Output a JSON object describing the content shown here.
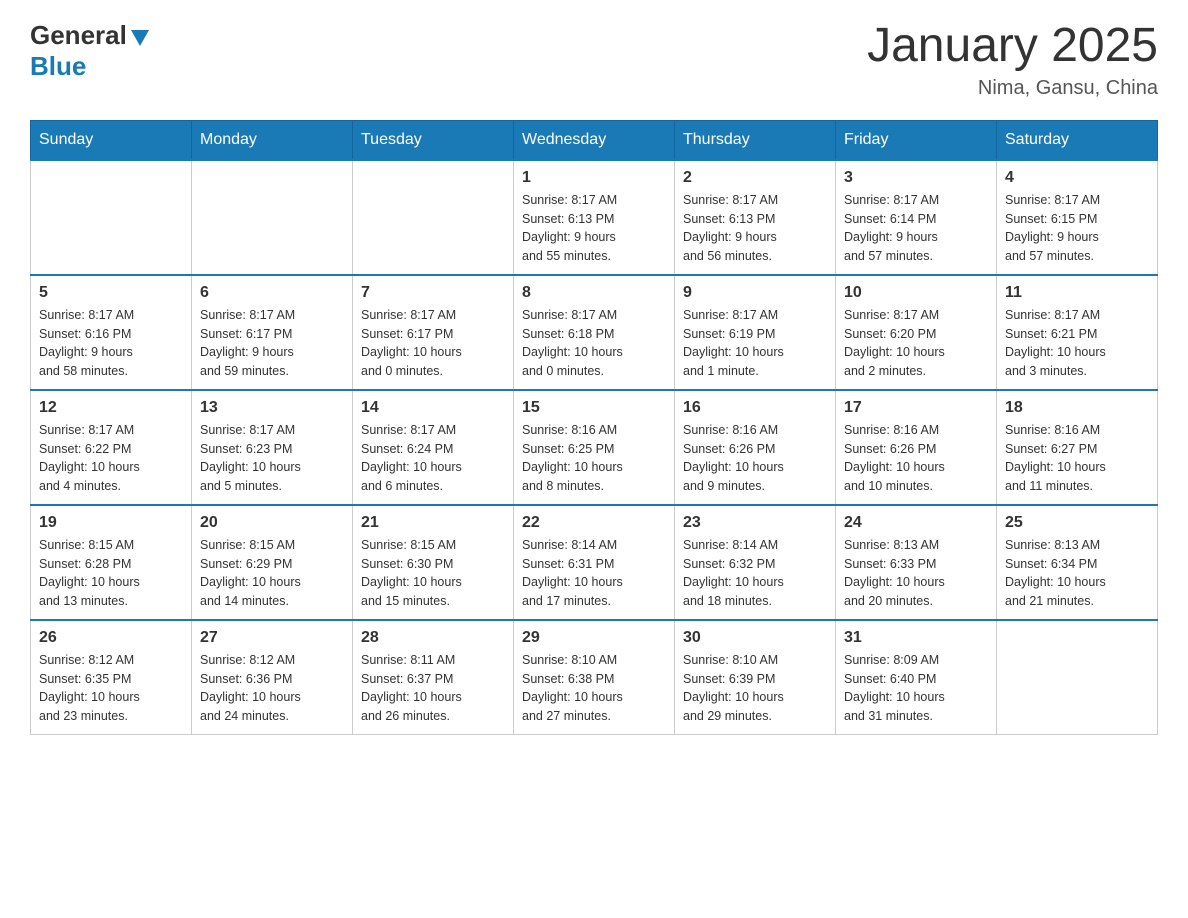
{
  "header": {
    "logo": {
      "general": "General",
      "blue": "Blue",
      "tagline": "Blue"
    },
    "title": "January 2025",
    "location": "Nima, Gansu, China"
  },
  "days_of_week": [
    "Sunday",
    "Monday",
    "Tuesday",
    "Wednesday",
    "Thursday",
    "Friday",
    "Saturday"
  ],
  "weeks": [
    [
      {
        "day": "",
        "info": ""
      },
      {
        "day": "",
        "info": ""
      },
      {
        "day": "",
        "info": ""
      },
      {
        "day": "1",
        "info": "Sunrise: 8:17 AM\nSunset: 6:13 PM\nDaylight: 9 hours\nand 55 minutes."
      },
      {
        "day": "2",
        "info": "Sunrise: 8:17 AM\nSunset: 6:13 PM\nDaylight: 9 hours\nand 56 minutes."
      },
      {
        "day": "3",
        "info": "Sunrise: 8:17 AM\nSunset: 6:14 PM\nDaylight: 9 hours\nand 57 minutes."
      },
      {
        "day": "4",
        "info": "Sunrise: 8:17 AM\nSunset: 6:15 PM\nDaylight: 9 hours\nand 57 minutes."
      }
    ],
    [
      {
        "day": "5",
        "info": "Sunrise: 8:17 AM\nSunset: 6:16 PM\nDaylight: 9 hours\nand 58 minutes."
      },
      {
        "day": "6",
        "info": "Sunrise: 8:17 AM\nSunset: 6:17 PM\nDaylight: 9 hours\nand 59 minutes."
      },
      {
        "day": "7",
        "info": "Sunrise: 8:17 AM\nSunset: 6:17 PM\nDaylight: 10 hours\nand 0 minutes."
      },
      {
        "day": "8",
        "info": "Sunrise: 8:17 AM\nSunset: 6:18 PM\nDaylight: 10 hours\nand 0 minutes."
      },
      {
        "day": "9",
        "info": "Sunrise: 8:17 AM\nSunset: 6:19 PM\nDaylight: 10 hours\nand 1 minute."
      },
      {
        "day": "10",
        "info": "Sunrise: 8:17 AM\nSunset: 6:20 PM\nDaylight: 10 hours\nand 2 minutes."
      },
      {
        "day": "11",
        "info": "Sunrise: 8:17 AM\nSunset: 6:21 PM\nDaylight: 10 hours\nand 3 minutes."
      }
    ],
    [
      {
        "day": "12",
        "info": "Sunrise: 8:17 AM\nSunset: 6:22 PM\nDaylight: 10 hours\nand 4 minutes."
      },
      {
        "day": "13",
        "info": "Sunrise: 8:17 AM\nSunset: 6:23 PM\nDaylight: 10 hours\nand 5 minutes."
      },
      {
        "day": "14",
        "info": "Sunrise: 8:17 AM\nSunset: 6:24 PM\nDaylight: 10 hours\nand 6 minutes."
      },
      {
        "day": "15",
        "info": "Sunrise: 8:16 AM\nSunset: 6:25 PM\nDaylight: 10 hours\nand 8 minutes."
      },
      {
        "day": "16",
        "info": "Sunrise: 8:16 AM\nSunset: 6:26 PM\nDaylight: 10 hours\nand 9 minutes."
      },
      {
        "day": "17",
        "info": "Sunrise: 8:16 AM\nSunset: 6:26 PM\nDaylight: 10 hours\nand 10 minutes."
      },
      {
        "day": "18",
        "info": "Sunrise: 8:16 AM\nSunset: 6:27 PM\nDaylight: 10 hours\nand 11 minutes."
      }
    ],
    [
      {
        "day": "19",
        "info": "Sunrise: 8:15 AM\nSunset: 6:28 PM\nDaylight: 10 hours\nand 13 minutes."
      },
      {
        "day": "20",
        "info": "Sunrise: 8:15 AM\nSunset: 6:29 PM\nDaylight: 10 hours\nand 14 minutes."
      },
      {
        "day": "21",
        "info": "Sunrise: 8:15 AM\nSunset: 6:30 PM\nDaylight: 10 hours\nand 15 minutes."
      },
      {
        "day": "22",
        "info": "Sunrise: 8:14 AM\nSunset: 6:31 PM\nDaylight: 10 hours\nand 17 minutes."
      },
      {
        "day": "23",
        "info": "Sunrise: 8:14 AM\nSunset: 6:32 PM\nDaylight: 10 hours\nand 18 minutes."
      },
      {
        "day": "24",
        "info": "Sunrise: 8:13 AM\nSunset: 6:33 PM\nDaylight: 10 hours\nand 20 minutes."
      },
      {
        "day": "25",
        "info": "Sunrise: 8:13 AM\nSunset: 6:34 PM\nDaylight: 10 hours\nand 21 minutes."
      }
    ],
    [
      {
        "day": "26",
        "info": "Sunrise: 8:12 AM\nSunset: 6:35 PM\nDaylight: 10 hours\nand 23 minutes."
      },
      {
        "day": "27",
        "info": "Sunrise: 8:12 AM\nSunset: 6:36 PM\nDaylight: 10 hours\nand 24 minutes."
      },
      {
        "day": "28",
        "info": "Sunrise: 8:11 AM\nSunset: 6:37 PM\nDaylight: 10 hours\nand 26 minutes."
      },
      {
        "day": "29",
        "info": "Sunrise: 8:10 AM\nSunset: 6:38 PM\nDaylight: 10 hours\nand 27 minutes."
      },
      {
        "day": "30",
        "info": "Sunrise: 8:10 AM\nSunset: 6:39 PM\nDaylight: 10 hours\nand 29 minutes."
      },
      {
        "day": "31",
        "info": "Sunrise: 8:09 AM\nSunset: 6:40 PM\nDaylight: 10 hours\nand 31 minutes."
      },
      {
        "day": "",
        "info": ""
      }
    ]
  ]
}
